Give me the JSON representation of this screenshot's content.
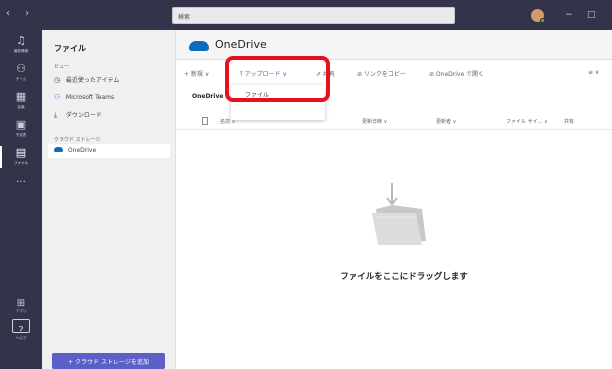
{
  "titlebar": {
    "nav": "‹ ›",
    "search_placeholder": "検索"
  },
  "rail": {
    "items": [
      {
        "icon": "bell-icon",
        "label": "最新情報"
      },
      {
        "icon": "people-icon",
        "label": "チーム"
      },
      {
        "icon": "calendar-icon",
        "label": "会議"
      },
      {
        "icon": "phone-icon",
        "label": "予定表"
      },
      {
        "icon": "file-icon",
        "label": "ファイル"
      }
    ],
    "more": "…",
    "apps": "アプリ",
    "help": "ヘルプ"
  },
  "panel": {
    "title": "ファイル",
    "view_label": "ビュー",
    "items": [
      {
        "icon": "clock-icon",
        "label": "最近使ったアイテム"
      },
      {
        "icon": "teams-icon",
        "label": "Microsoft Teams"
      },
      {
        "icon": "download-icon",
        "label": "ダウンロード"
      }
    ],
    "cloud_label": "クラウド ストレージ",
    "cloud_items": [
      {
        "label": "OneDrive"
      }
    ],
    "add_storage": "+ クラウド ストレージを追加"
  },
  "main": {
    "title": "OneDrive",
    "toolbar": {
      "new": "+ 新規 ∨",
      "upload": "⤒ アップロード ∨",
      "share": "⇗ 共有",
      "copy_link": "⊘ リンクをコピー",
      "open_onedrive": "⊘ OneDrive で開く",
      "view": "≡ ∨"
    },
    "breadcrumb": "OneDrive",
    "columns": [
      "名前 ∨",
      "更新日時 ∨",
      "更新者 ∨",
      "ファイル サイ... ∨",
      "共有"
    ],
    "dropdown": {
      "items": [
        "ファイル"
      ]
    },
    "empty_text": "ファイルをここにドラッグします"
  },
  "colors": {
    "accent": "#5b5fc7",
    "rail": "#33344a",
    "highlight": "#e8101f",
    "onedrive": "#0f6cbd"
  }
}
